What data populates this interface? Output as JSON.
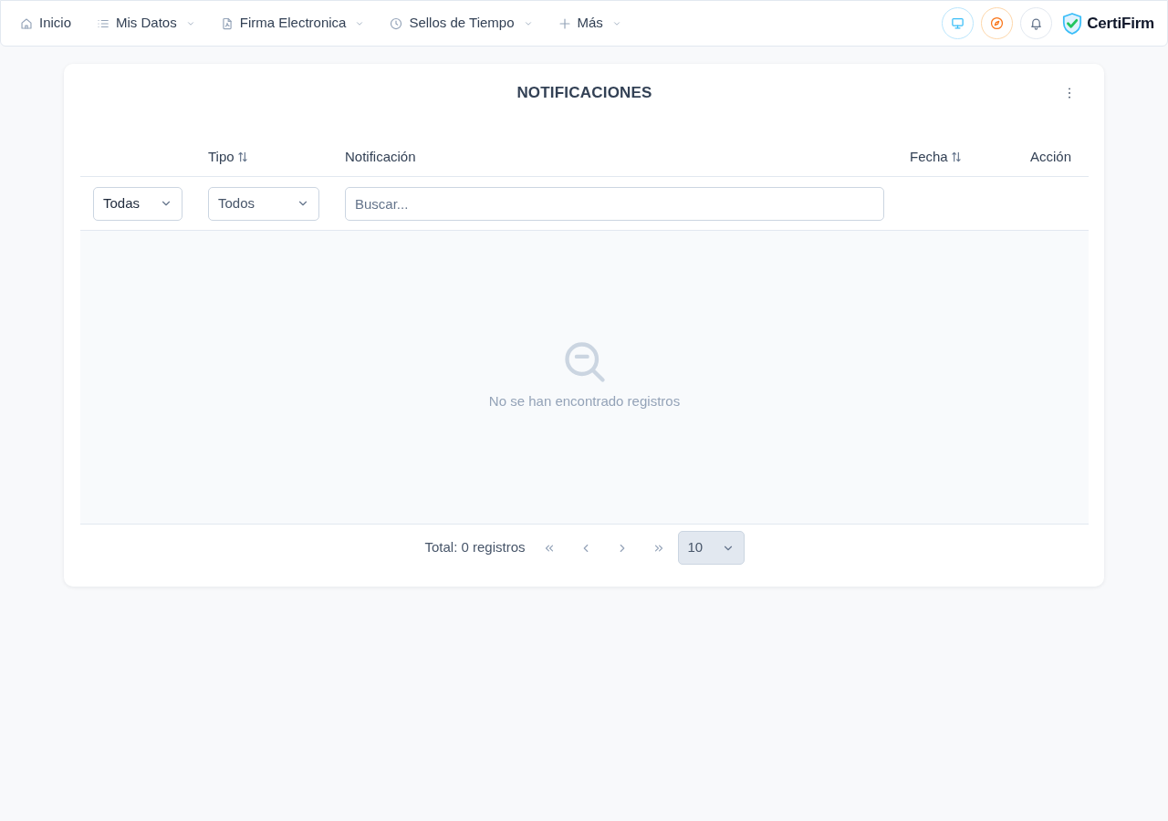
{
  "navbar": {
    "items": [
      {
        "label": "Inicio",
        "dropdown": false
      },
      {
        "label": "Mis Datos",
        "dropdown": true
      },
      {
        "label": "Firma Electronica",
        "dropdown": true
      },
      {
        "label": "Sellos de Tiempo",
        "dropdown": true
      },
      {
        "label": "Más",
        "dropdown": true
      }
    ],
    "brand": "CertiFirm"
  },
  "panel": {
    "title": "NOTIFICACIONES",
    "table": {
      "columns": [
        {
          "filter": {
            "kind": "select",
            "value": "Todas"
          }
        },
        {
          "label": "Tipo",
          "sortable": true,
          "filter": {
            "kind": "select",
            "value": "Todos"
          }
        },
        {
          "label": "Notificación",
          "sortable": false,
          "filter": {
            "kind": "search",
            "placeholder": "Buscar..."
          }
        },
        {
          "label": "Fecha",
          "sortable": true
        },
        {
          "label": "Acción",
          "sortable": false
        }
      ],
      "empty_message": "No se han encontrado registros"
    },
    "pagination": {
      "total": "Total: 0 registros",
      "page_size": {
        "value": "10",
        "disabled": true
      }
    }
  }
}
